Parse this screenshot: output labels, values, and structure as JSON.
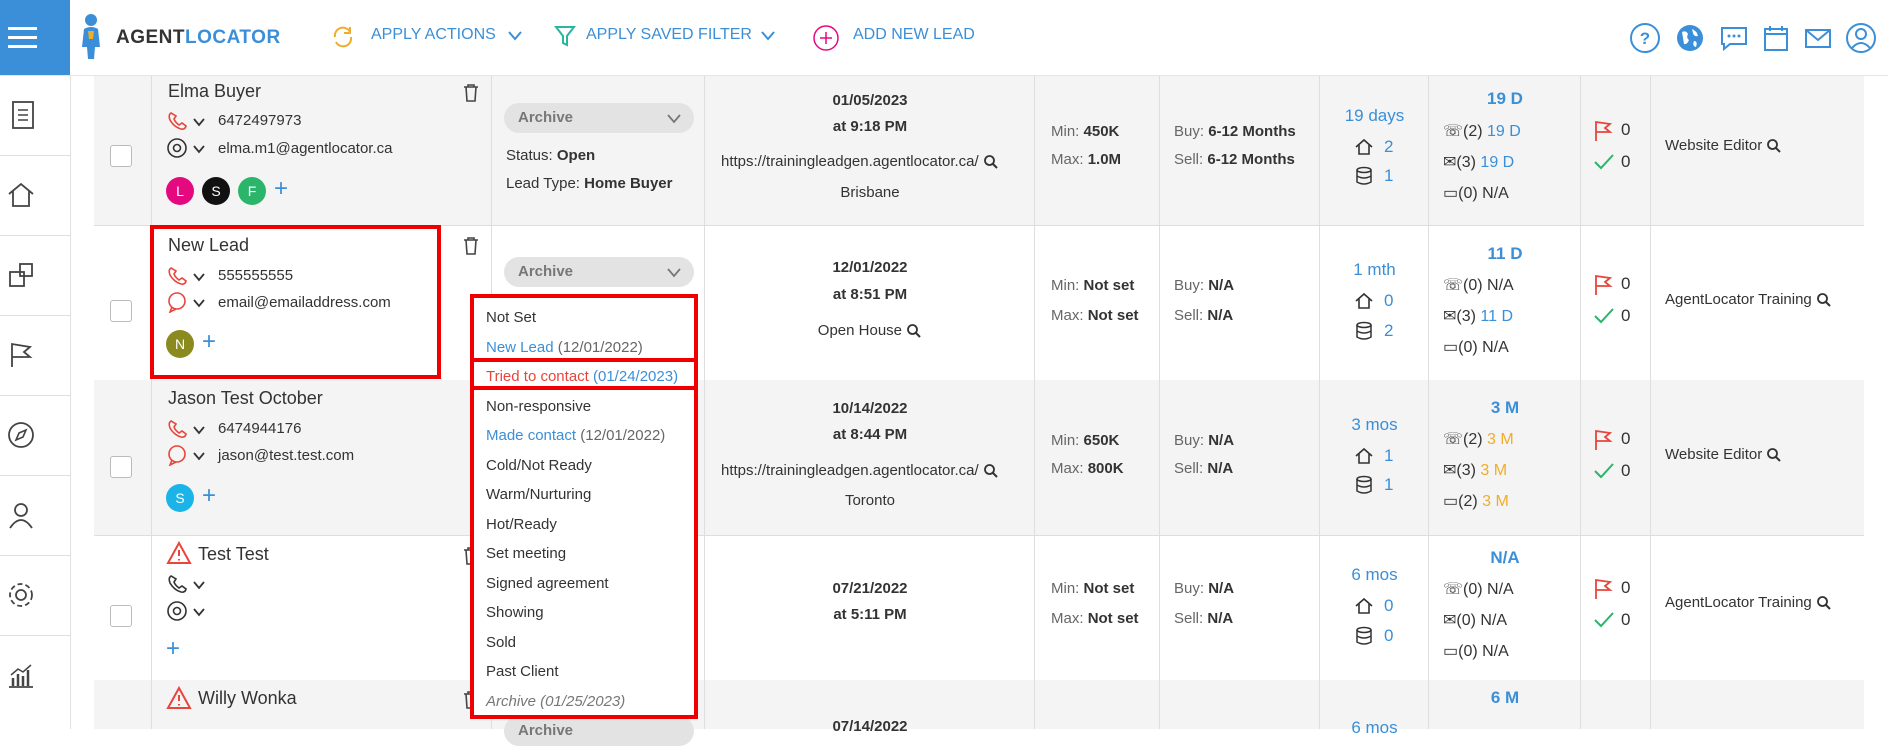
{
  "app": {
    "logo_part1": "AGENT",
    "logo_part2": "LOCATOR"
  },
  "toolbar": {
    "apply_actions": "APPLY ACTIONS",
    "apply_saved_filter": "APPLY SAVED FILTER",
    "add_new_lead": "ADD NEW LEAD"
  },
  "sidebar": {
    "items": [
      "documents-icon",
      "home-icon",
      "listings-icon",
      "flag-icon",
      "compass-icon",
      "user-icon",
      "settings-icon",
      "analytics-icon"
    ]
  },
  "rows": [
    {
      "name": "Elma Buyer",
      "phone": "6472497973",
      "email": "elma.m1@agentlocator.ca",
      "avatars": [
        {
          "letter": "L",
          "color": "#e5097f"
        },
        {
          "letter": "S",
          "color": "#111111"
        },
        {
          "letter": "F",
          "color": "#2bb56a"
        }
      ],
      "stage": "Archive",
      "status_label": "Status:",
      "status_value": "Open",
      "leadtype_label": "Lead Type:",
      "leadtype_value": "Home Buyer",
      "date": "01/05/2023",
      "time": "at 9:18 PM",
      "source": "https://trainingleadgen.agentlocator.ca/",
      "city": "Brisbane",
      "min_label": "Min:",
      "min": "450K",
      "max_label": "Max:",
      "max": "1.0M",
      "buy_label": "Buy:",
      "buy": "6-12 Months",
      "sell_label": "Sell:",
      "sell": "6-12 Months",
      "age": "19 days",
      "homes": "2",
      "db": "1",
      "last": "19 D",
      "calls": "(2)",
      "calls_when": "19 D",
      "emails": "(3)",
      "emails_when": "19 D",
      "texts": "(0)",
      "texts_when": "N/A",
      "flags": "0",
      "checks": "0",
      "agent": "Website Editor"
    },
    {
      "name": "New Lead",
      "phone": "555555555",
      "email": "email@emailaddress.com",
      "avatars": [
        {
          "letter": "N",
          "color": "#8a8a1e"
        }
      ],
      "stage": "Archive",
      "date": "12/01/2022",
      "time": "at 8:51 PM",
      "source": "Open House",
      "min_label": "Min:",
      "min": "Not set",
      "max_label": "Max:",
      "max": "Not set",
      "buy_label": "Buy:",
      "buy": "N/A",
      "sell_label": "Sell:",
      "sell": "N/A",
      "age": "1 mth",
      "homes": "0",
      "db": "2",
      "last": "11 D",
      "calls": "(0) N/A",
      "emails": "(3)",
      "emails_when": "11 D",
      "texts": "(0) N/A",
      "flags": "0",
      "checks": "0",
      "agent": "AgentLocator Training"
    },
    {
      "name": "Jason Test October",
      "phone": "6474944176",
      "email": "jason@test.test.com",
      "avatars": [
        {
          "letter": "S",
          "color": "#1ab4e8"
        }
      ],
      "date": "10/14/2022",
      "time": "at 8:44 PM",
      "source": "https://trainingleadgen.agentlocator.ca/",
      "city": "Toronto",
      "min_label": "Min:",
      "min": "650K",
      "max_label": "Max:",
      "max": "800K",
      "buy_label": "Buy:",
      "buy": "N/A",
      "sell_label": "Sell:",
      "sell": "N/A",
      "age": "3 mos",
      "homes": "1",
      "db": "1",
      "last": "3 M",
      "calls": "(2)",
      "calls_when": "3 M",
      "emails": "(3)",
      "emails_when": "3 M",
      "texts": "(2)",
      "texts_when": "3 M",
      "flags": "0",
      "checks": "0",
      "agent": "Website Editor"
    },
    {
      "name": "Test Test",
      "date": "07/21/2022",
      "time": "at 5:11 PM",
      "min_label": "Min:",
      "min": "Not set",
      "max_label": "Max:",
      "max": "Not set",
      "buy_label": "Buy:",
      "buy": "N/A",
      "sell_label": "Sell:",
      "sell": "N/A",
      "age": "6 mos",
      "homes": "0",
      "db": "0",
      "last": "N/A",
      "calls": "(0) N/A",
      "emails": "(0) N/A",
      "texts": "(0) N/A",
      "flags": "0",
      "checks": "0",
      "agent": "AgentLocator Training"
    },
    {
      "name": "Willy Wonka",
      "stage": "Archive",
      "date": "07/14/2022",
      "age": "6 mos",
      "last": "6 M"
    }
  ],
  "stage_menu": {
    "items": [
      {
        "label": "Not Set",
        "date": "",
        "style": "normal"
      },
      {
        "label": "New Lead",
        "date": "(12/01/2022)",
        "style": "done"
      },
      {
        "label": "Tried to contact",
        "date": "(01/24/2023)",
        "style": "current"
      },
      {
        "label": "Non-responsive",
        "date": "",
        "style": "normal"
      },
      {
        "label": "Made contact",
        "date": "(12/01/2022)",
        "style": "done"
      },
      {
        "label": "Cold/Not Ready",
        "date": "",
        "style": "normal"
      },
      {
        "label": "Warm/Nurturing",
        "date": "",
        "style": "normal"
      },
      {
        "label": "Hot/Ready",
        "date": "",
        "style": "normal"
      },
      {
        "label": "Set meeting",
        "date": "",
        "style": "normal"
      },
      {
        "label": "Signed agreement",
        "date": "",
        "style": "normal"
      },
      {
        "label": "Showing",
        "date": "",
        "style": "normal"
      },
      {
        "label": "Sold",
        "date": "",
        "style": "normal"
      },
      {
        "label": "Past Client",
        "date": "",
        "style": "normal"
      },
      {
        "label": "Archive (01/25/2023)",
        "date": "",
        "style": "archived"
      }
    ]
  },
  "colors": {
    "accent": "#3a8fd8",
    "highlight": "#e00000",
    "flag": "#e8453c",
    "check": "#2bb56a",
    "due": "#f0ad2a"
  }
}
